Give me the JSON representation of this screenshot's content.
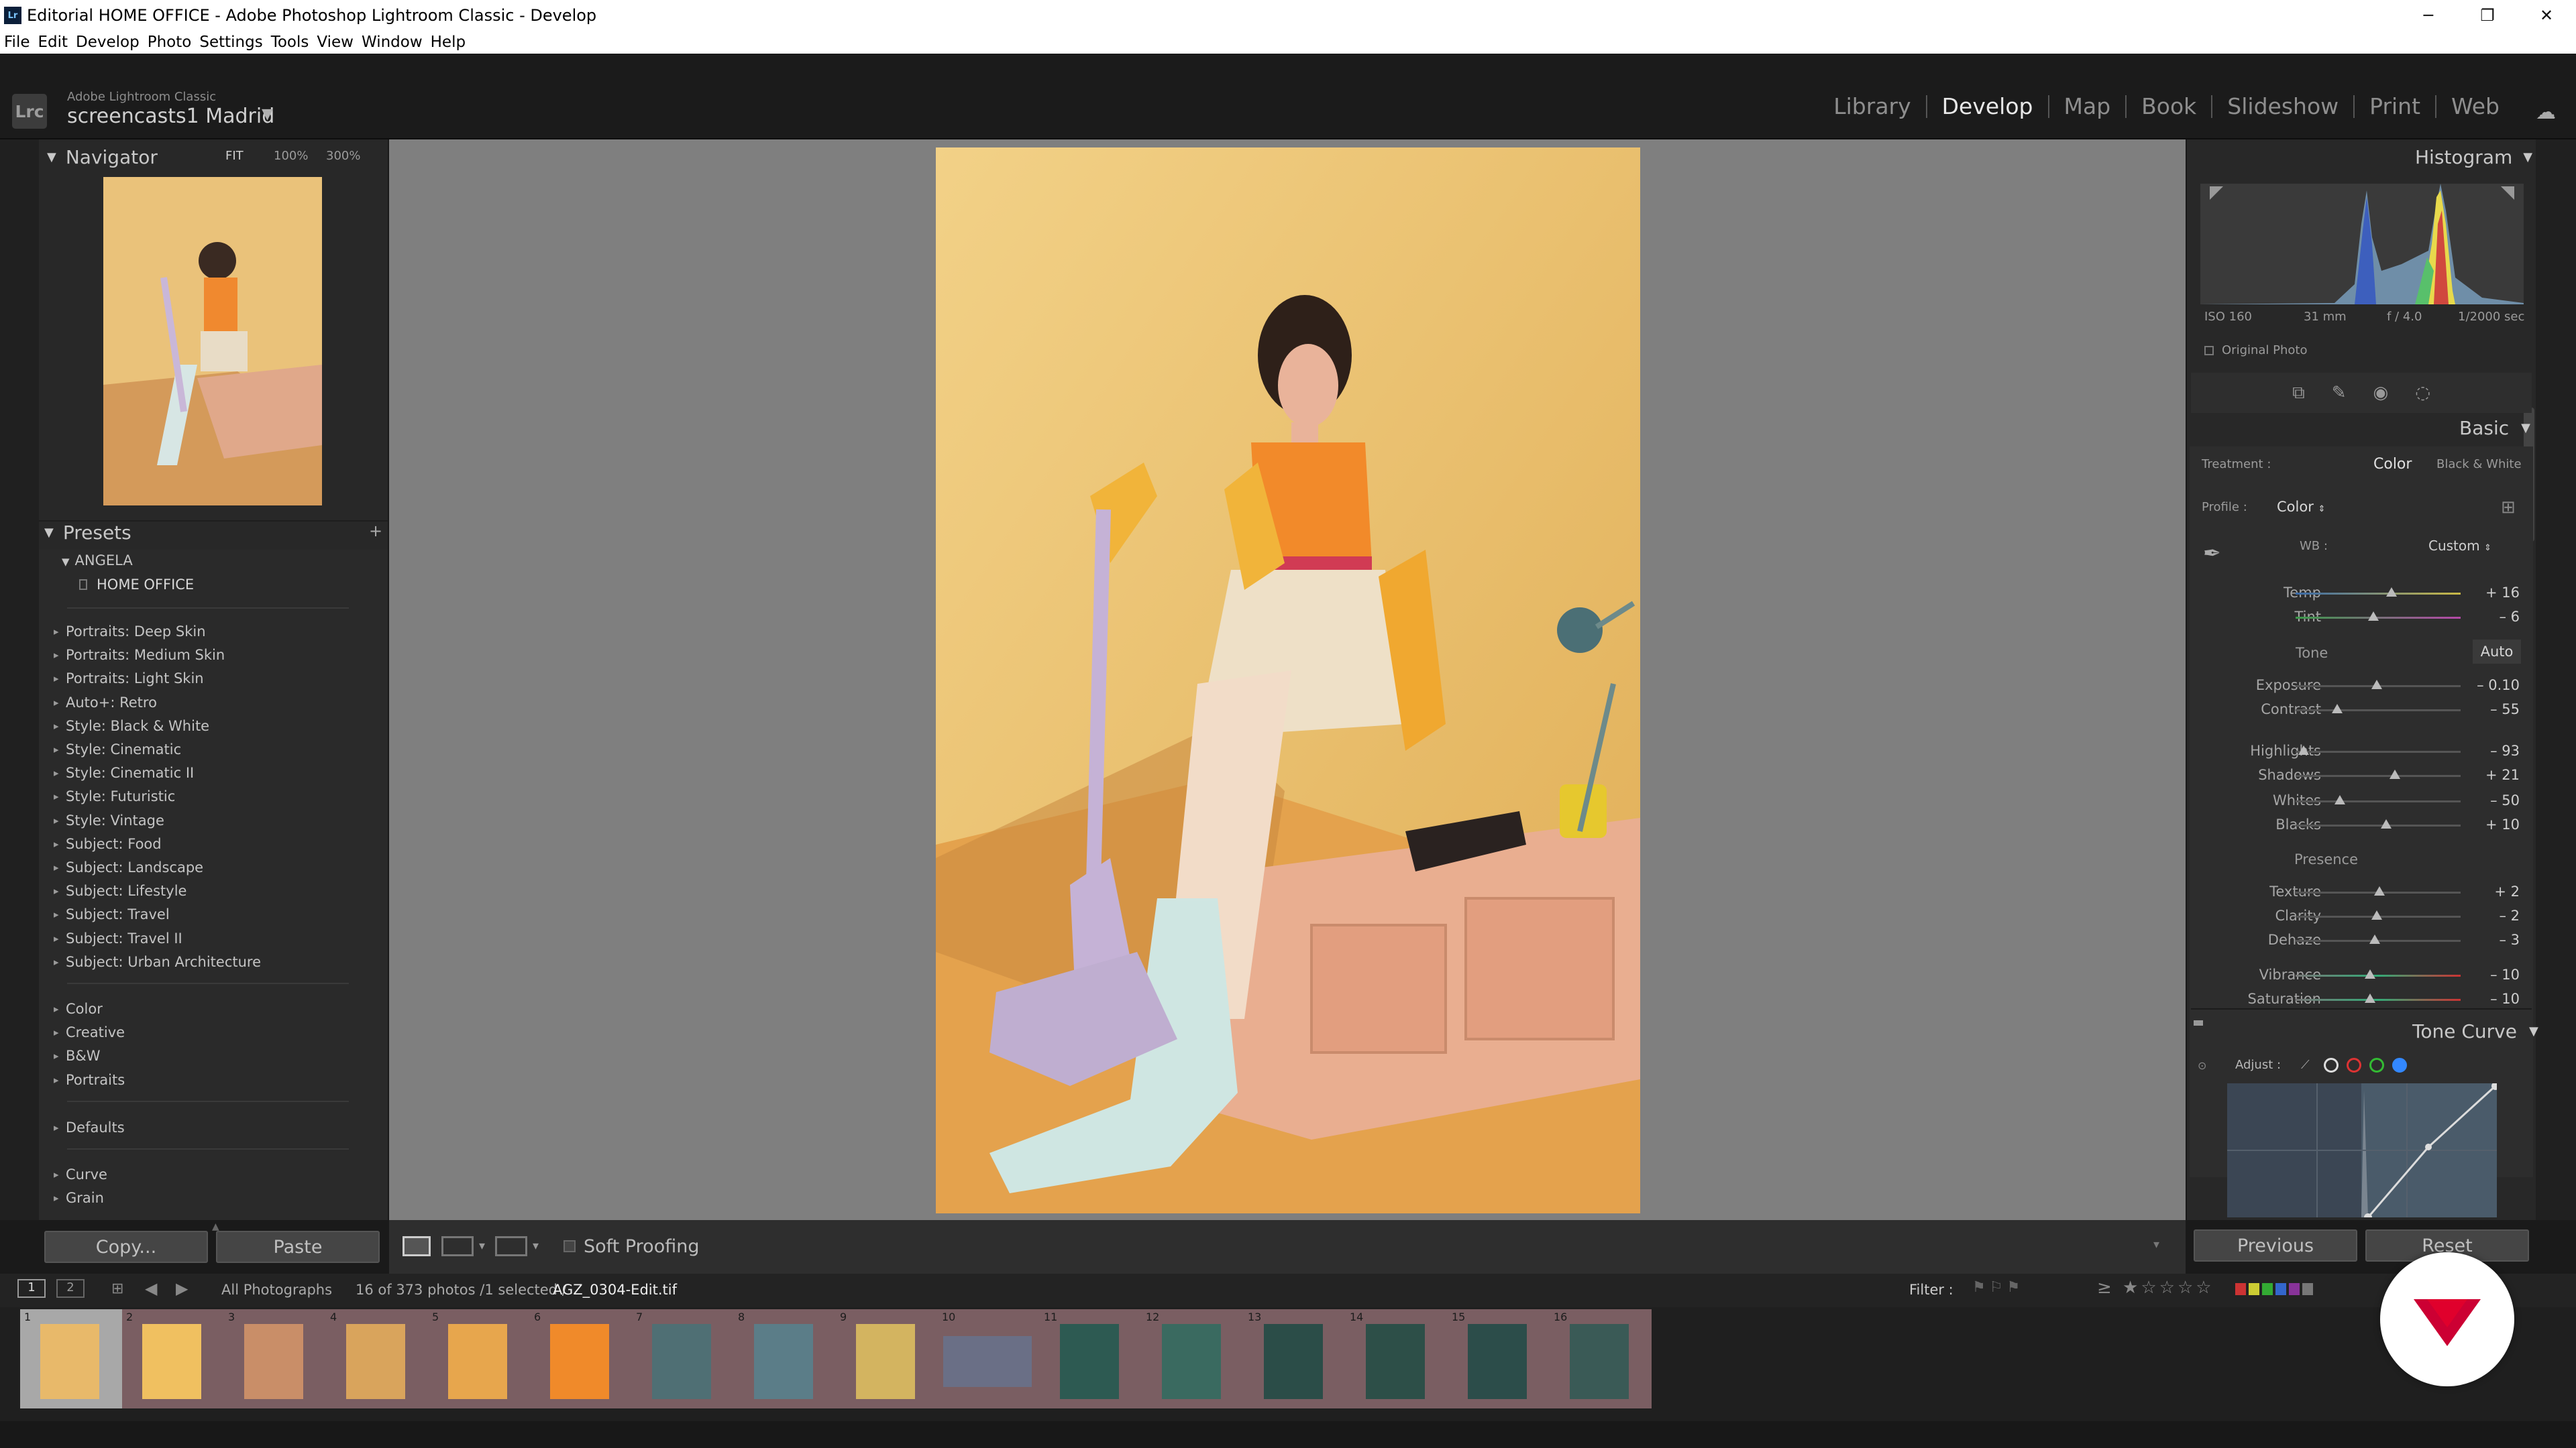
{
  "titlebar": {
    "title": "Editorial HOME OFFICE - Adobe Photoshop Lightroom Classic - Develop",
    "minimize": "─",
    "maximize": "❐",
    "close": "✕"
  },
  "menu": [
    "File",
    "Edit",
    "Develop",
    "Photo",
    "Settings",
    "Tools",
    "View",
    "Window",
    "Help"
  ],
  "identity": {
    "app_name": "Adobe Lightroom Classic",
    "catalog": "screencasts1 Madrid",
    "logo": "Lrc"
  },
  "modules": [
    "Library",
    "Develop",
    "Map",
    "Book",
    "Slideshow",
    "Print",
    "Web"
  ],
  "active_module": "Develop",
  "navigator": {
    "title": "Navigator",
    "zoom": [
      "FIT",
      "100%",
      "300%"
    ]
  },
  "presets": {
    "title": "Presets",
    "user_group": "ANGELA",
    "user_item": "HOME OFFICE",
    "groups1": [
      "Portraits: Deep Skin",
      "Portraits: Medium Skin",
      "Portraits: Light Skin",
      "Auto+: Retro",
      "Style: Black & White",
      "Style: Cinematic",
      "Style: Cinematic II",
      "Style: Futuristic",
      "Style: Vintage",
      "Subject: Food",
      "Subject: Landscape",
      "Subject: Lifestyle",
      "Subject: Travel",
      "Subject: Travel II",
      "Subject: Urban Architecture"
    ],
    "groups2": [
      "Color",
      "Creative",
      "B&W",
      "Portraits"
    ],
    "groups3": [
      "Defaults"
    ],
    "groups4": [
      "Curve",
      "Grain"
    ]
  },
  "left_buttons": {
    "copy": "Copy...",
    "paste": "Paste"
  },
  "toolbar": {
    "soft_proofing": "Soft Proofing"
  },
  "histogram": {
    "title": "Histogram",
    "iso": "ISO 160",
    "focal": "31 mm",
    "aperture": "f / 4.0",
    "shutter": "1/2000 sec",
    "original": "Original Photo"
  },
  "basic": {
    "title": "Basic",
    "treatment_label": "Treatment :",
    "treatment_color": "Color",
    "treatment_bw": "Black & White",
    "profile_label": "Profile :",
    "profile_value": "Color",
    "wb_label": "WB :",
    "wb_value": "Custom",
    "tone_label": "Tone",
    "auto": "Auto",
    "presence_label": "Presence",
    "sliders": [
      {
        "label": "Temp",
        "value": "+ 16",
        "pos": 0.58
      },
      {
        "label": "Tint",
        "value": "– 6",
        "pos": 0.47
      },
      {
        "label": "Exposure",
        "value": "– 0.10",
        "pos": 0.49
      },
      {
        "label": "Contrast",
        "value": "– 55",
        "pos": 0.25
      },
      {
        "label": "Highlights",
        "value": "– 93",
        "pos": 0.05
      },
      {
        "label": "Shadows",
        "value": "+ 21",
        "pos": 0.6
      },
      {
        "label": "Whites",
        "value": "– 50",
        "pos": 0.27
      },
      {
        "label": "Blacks",
        "value": "+ 10",
        "pos": 0.55
      },
      {
        "label": "Texture",
        "value": "+ 2",
        "pos": 0.51
      },
      {
        "label": "Clarity",
        "value": "– 2",
        "pos": 0.49
      },
      {
        "label": "Dehaze",
        "value": "– 3",
        "pos": 0.48
      },
      {
        "label": "Vibrance",
        "value": "– 10",
        "pos": 0.45
      },
      {
        "label": "Saturation",
        "value": "– 10",
        "pos": 0.45
      }
    ]
  },
  "tone_curve": {
    "title": "Tone Curve",
    "adjust": "Adjust :"
  },
  "right_buttons": {
    "previous": "Previous",
    "reset": "Reset"
  },
  "filmbar": {
    "page1": "1",
    "page2": "2",
    "source": "All Photographs",
    "count": "16 of 373 photos /1 selected /",
    "filename": "AGZ_0304-Edit.tif",
    "filter": "Filter :"
  },
  "film_numbers": [
    "1",
    "2",
    "3",
    "4",
    "5",
    "6",
    "7",
    "8",
    "9",
    "10",
    "11",
    "12",
    "13",
    "14",
    "15",
    "16"
  ],
  "colors": {
    "accent": "#cc0033",
    "panel": "#282828",
    "center_bg": "#7f7f7f"
  }
}
